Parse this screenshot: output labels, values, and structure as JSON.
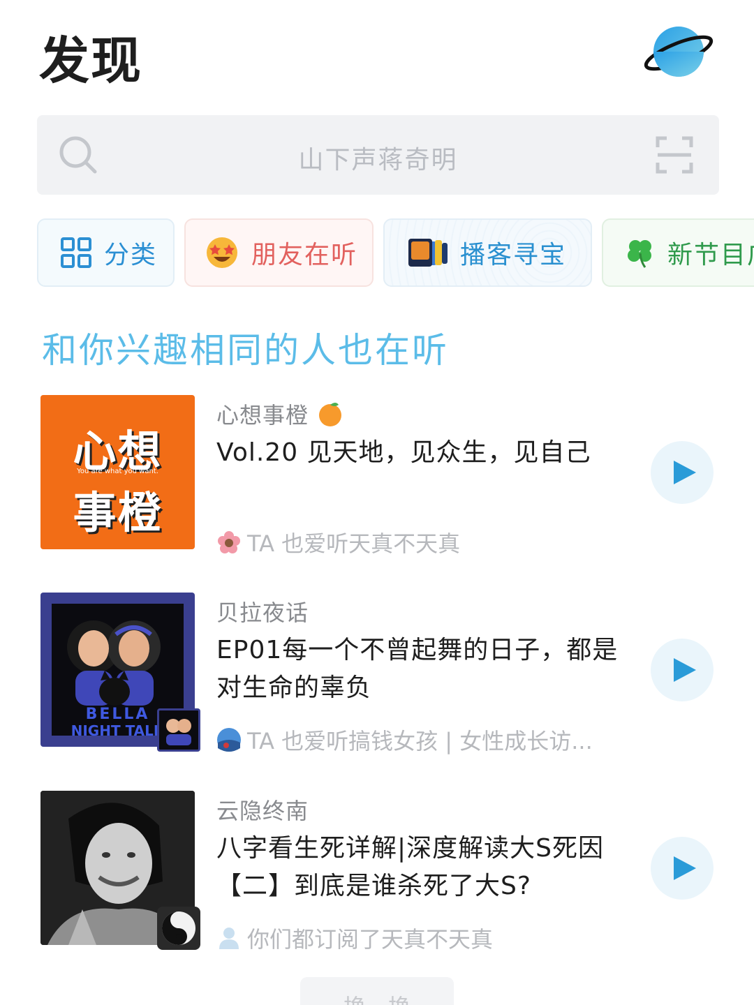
{
  "header": {
    "title": "发现"
  },
  "search": {
    "placeholder": "山下声蒋奇明"
  },
  "chips": [
    {
      "label": "分类"
    },
    {
      "label": "朋友在听"
    },
    {
      "label": "播客寻宝"
    },
    {
      "label": "新节目广"
    }
  ],
  "section": {
    "title": "和你兴趣相同的人也在听"
  },
  "items": [
    {
      "podcast": "心想事橙",
      "title": "Vol.20 见天地，见众生，见自己",
      "meta": "TA 也爱听天真不天真",
      "cover_text_top": "心想",
      "cover_text_sub": "You are what you want.",
      "cover_text_bottom": "事橙"
    },
    {
      "podcast": "贝拉夜话",
      "title": "EP01每一个不曾起舞的日子，都是对生命的辜负",
      "meta": "TA 也爱听搞钱女孩 | 女性成长访...",
      "cover_text_top": "BELLA",
      "cover_text_bottom": "NIGHT TALK"
    },
    {
      "podcast": "云隐终南",
      "title": "八字看生死详解|深度解读大S死因【二】到底是谁杀死了大S?",
      "meta": "你们都订阅了天真不天真"
    }
  ],
  "footer": {
    "refresh_label": "换一换"
  },
  "colors": {
    "accent": "#5bbce8",
    "play": "#2a9bd8"
  }
}
